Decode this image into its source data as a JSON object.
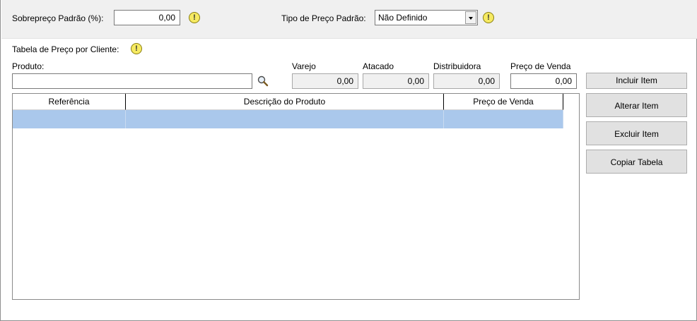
{
  "header": {
    "sobrepreco_label": "Sobrepreço Padrão (%):",
    "sobrepreco_value": "0,00",
    "tipo_preco_label": "Tipo de Preço Padrão:",
    "tipo_preco_value": "Não Definido",
    "warn_glyph": "!"
  },
  "tabela": {
    "section_label": "Tabela de Preço por Cliente:",
    "produto_label": "Produto:",
    "produto_value": "",
    "varejo_label": "Varejo",
    "varejo_value": "0,00",
    "atacado_label": "Atacado",
    "atacado_value": "0,00",
    "distribuidora_label": "Distribuidora",
    "distribuidora_value": "0,00",
    "preco_venda_label": "Preço de Venda",
    "preco_venda_value": "0,00"
  },
  "grid": {
    "columns": [
      "Referência",
      "Descrição do Produto",
      "Preço de Venda"
    ],
    "rows": [
      {
        "referencia": "",
        "descricao": "",
        "preco": "",
        "selected": true
      }
    ]
  },
  "buttons": {
    "incluir": "Incluir Item",
    "alterar": "Alterar Item",
    "excluir": "Excluir Item",
    "copiar": "Copiar Tabela"
  },
  "colors": {
    "top_band": "#f0f0f0",
    "selected_row": "#aac8ec",
    "warn_fill": "#f6ea62"
  },
  "icons": [
    "warning-icon",
    "search-icon",
    "chevron-down-icon"
  ]
}
